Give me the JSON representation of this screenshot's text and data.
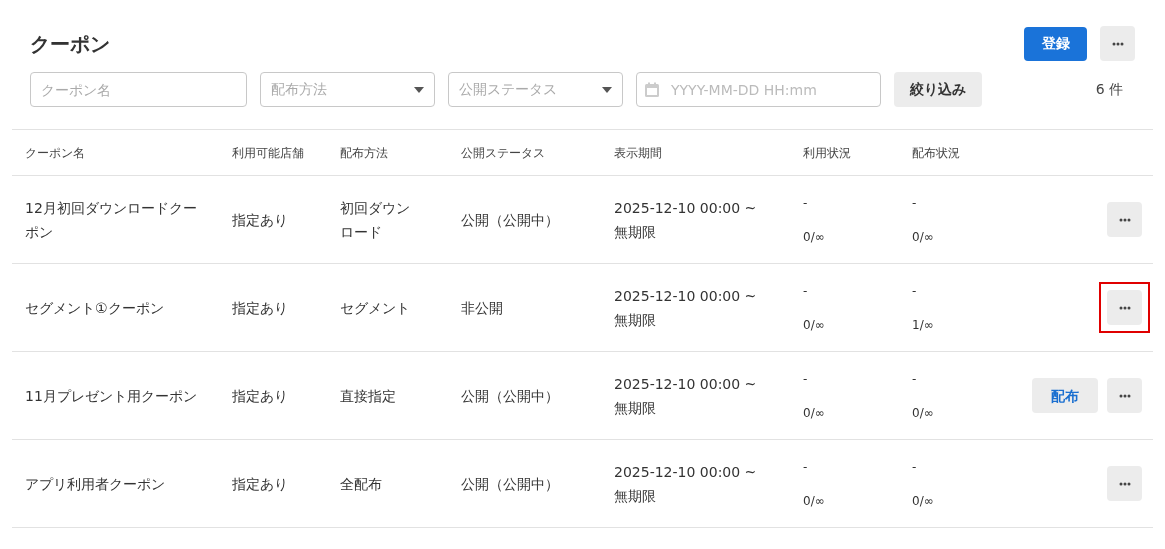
{
  "title": "クーポン",
  "register_button": "登録",
  "filters": {
    "name_placeholder": "クーポン名",
    "method_placeholder": "配布方法",
    "status_placeholder": "公開ステータス",
    "date_placeholder": "YYYY-MM-DD HH:mm",
    "apply_button": "絞り込み",
    "count": "6 件"
  },
  "table": {
    "columns": [
      "クーポン名",
      "利用可能店舗",
      "配布方法",
      "公開ステータス",
      "表示期間",
      "利用状況",
      "配布状況"
    ],
    "rows": [
      {
        "name": "12月初回ダウンロードクーポン",
        "stores": "指定あり",
        "method": "初回ダウンロード",
        "status": "公開（公開中）",
        "period_start": "2025-12-10 00:00 ~",
        "period_end": "無期限",
        "usage_top": "-",
        "usage": "0/∞",
        "distribution_top": "-",
        "distribution": "0/∞",
        "distribute_button": null,
        "highlighted": false
      },
      {
        "name": "セグメント①クーポン",
        "stores": "指定あり",
        "method": "セグメント",
        "status": "非公開",
        "period_start": "2025-12-10 00:00 ~",
        "period_end": "無期限",
        "usage_top": "-",
        "usage": "0/∞",
        "distribution_top": "-",
        "distribution": "1/∞",
        "distribute_button": null,
        "highlighted": true
      },
      {
        "name": "11月プレゼント用クーポン",
        "stores": "指定あり",
        "method": "直接指定",
        "status": "公開（公開中）",
        "period_start": "2025-12-10 00:00 ~",
        "period_end": "無期限",
        "usage_top": "-",
        "usage": "0/∞",
        "distribution_top": "-",
        "distribution": "0/∞",
        "distribute_button": "配布",
        "highlighted": false
      },
      {
        "name": "アプリ利用者クーポン",
        "stores": "指定あり",
        "method": "全配布",
        "status": "公開（公開中）",
        "period_start": "2025-12-10 00:00 ~",
        "period_end": "無期限",
        "usage_top": "-",
        "usage": "0/∞",
        "distribution_top": "-",
        "distribution": "0/∞",
        "distribute_button": null,
        "highlighted": false
      }
    ]
  }
}
